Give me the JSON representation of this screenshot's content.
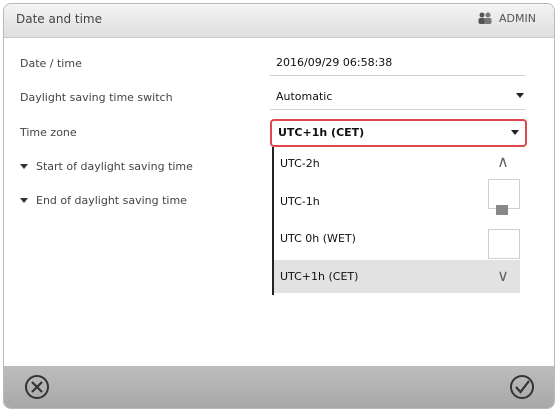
{
  "header": {
    "title": "Date and time",
    "user": "ADMIN",
    "user_icon": "user-icon"
  },
  "rows": [
    {
      "label": "Date / time",
      "value": "2016/09/29 06:58:38"
    },
    {
      "label": "Daylight saving time switch",
      "value": "Automatic"
    },
    {
      "label": "Time zone",
      "value": "UTC+1h (CET)"
    }
  ],
  "subsections": [
    {
      "label": "Start of daylight saving time"
    },
    {
      "label": "End of daylight saving time"
    }
  ],
  "timezone_options": [
    {
      "label": "UTC-2h"
    },
    {
      "label": "UTC-1h"
    },
    {
      "label": "UTC 0h (WET)"
    },
    {
      "label": "UTC+1h (CET)",
      "selected": true
    }
  ],
  "scroll_icons": {
    "up": "scroll-up-icon",
    "thumb": "scroll-thumb",
    "down": "scroll-down-icon"
  },
  "footer": {
    "cancel_icon": "cancel-icon",
    "confirm_icon": "confirm-icon"
  },
  "colors": {
    "highlight": "#e0464e",
    "footer": "#b3b3b3",
    "selected_row": "#e2e2e2"
  }
}
